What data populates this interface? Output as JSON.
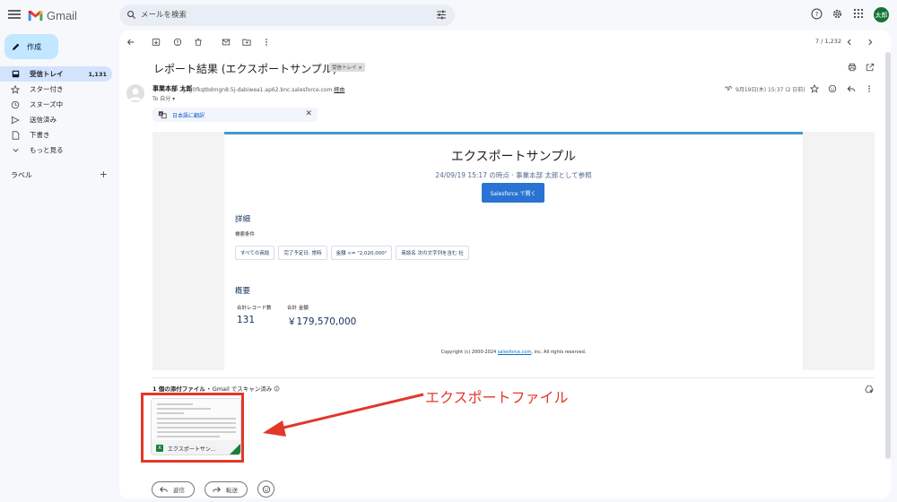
{
  "app": {
    "name": "Gmail",
    "avatar_text": "太郎"
  },
  "search": {
    "placeholder": "メールを検索"
  },
  "compose": {
    "label": "作成"
  },
  "nav": [
    {
      "label": "受信トレイ",
      "count": "1,131",
      "icon": "inbox-icon",
      "active": true
    },
    {
      "label": "スター付き",
      "icon": "star-icon"
    },
    {
      "label": "スヌーズ中",
      "icon": "clock-icon"
    },
    {
      "label": "送信済み",
      "icon": "send-icon"
    },
    {
      "label": "下書き",
      "icon": "draft-icon"
    },
    {
      "label": "もっと見る",
      "icon": "chevron-down-icon"
    }
  ],
  "labels": {
    "heading": "ラベル",
    "add_icon": "plus-icon"
  },
  "toolbar": {
    "pager": "7 / 1,232"
  },
  "message": {
    "subject": "レポート結果 (エクスポートサンプル)",
    "label_chip": "受信トレイ ×",
    "sender_name": "事業本部 太郎",
    "sender_email": "g1g0fkqtbdmgn8.5j-dabiwea1.ap62.bnc.salesforce.com",
    "via": "経由",
    "to": "To 自分 ▾",
    "date": "9月19日(木) 15:37 (2 日前)",
    "translate": "日本語に翻訳"
  },
  "report": {
    "title": "エクスポートサンプル",
    "subtitle": "24/09/19 15:17 の時点 · 事業本部 太郎として参照",
    "open_button": "Salesforce で開く",
    "details_heading": "詳細",
    "filters_label": "検索条件",
    "filters": [
      "すべての商談",
      "完了予定日: 常時",
      "金額 <= \"2,020,000\"",
      "商談名 次の文字列を含む 社"
    ],
    "summary_heading": "概要",
    "record_count_label": "合計レコード数",
    "record_count": "131",
    "amount_label": "合計 金額",
    "amount": "￥179,570,000",
    "copyright_pre": "Copyright (c) 2000-2024 ",
    "copyright_link": "salesforce.com",
    "copyright_post": ", inc. All rights reserved."
  },
  "attachments": {
    "heading": "1 個の添付ファイル",
    "scan_note": "Gmail でスキャン済み",
    "file_name": "エクスポートサン...",
    "file_type": "X"
  },
  "actions": {
    "reply": "返信",
    "forward": "転送"
  },
  "annotation": {
    "text": "エクスポートファイル",
    "color": "#e2382a"
  },
  "colors": {
    "accent": "#0b57d0",
    "active_nav": "#d3e3fd",
    "compose": "#c2e7ff",
    "excel": "#188038",
    "salesforce_button": "#2a73d2"
  }
}
